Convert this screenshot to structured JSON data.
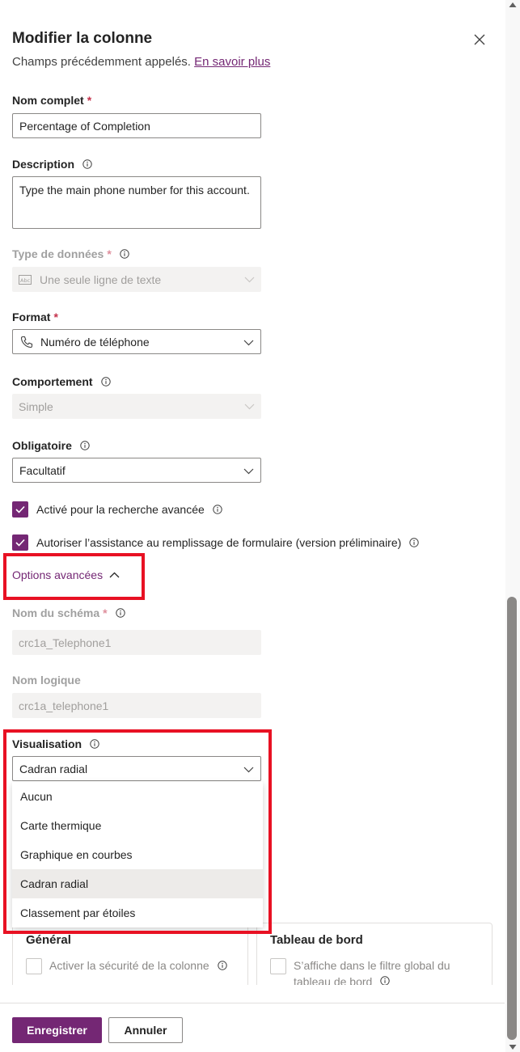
{
  "panel": {
    "title": "Modifier la colonne",
    "subtitle_prefix": "Champs précédemment appelés.",
    "learn_more_link": "En savoir plus"
  },
  "fields": {
    "display_name": {
      "label": "Nom complet",
      "required_mark": "*",
      "value": "Percentage of Completion"
    },
    "description": {
      "label": "Description",
      "value": "Type the main phone number for this account."
    },
    "data_type": {
      "label": "Type de données",
      "required_mark": "*",
      "value": "Une seule ligne de texte",
      "icon": "abc-text-icon"
    },
    "format": {
      "label": "Format",
      "required_mark": "*",
      "value": "Numéro de téléphone",
      "icon": "phone-icon"
    },
    "behavior": {
      "label": "Comportement",
      "value": "Simple"
    },
    "required": {
      "label": "Obligatoire",
      "value": "Facultatif"
    }
  },
  "checkboxes": {
    "advanced_find": {
      "label": "Activé pour la recherche avancée",
      "checked": true
    },
    "form_assist": {
      "label": "Autoriser l’assistance au remplissage de formulaire (version préliminaire)",
      "checked": true
    }
  },
  "advanced_options": {
    "toggle_label": "Options avancées",
    "schema_name": {
      "label": "Nom du schéma",
      "required_mark": "*",
      "value": "crc1a_Telephone1"
    },
    "logical_name": {
      "label": "Nom logique",
      "value": "crc1a_telephone1"
    },
    "visualization": {
      "label": "Visualisation",
      "value": "Cadran radial",
      "options": [
        "Aucun",
        "Carte thermique",
        "Graphique en courbes",
        "Cadran radial",
        "Classement par étoiles"
      ],
      "selected": "Cadran radial"
    }
  },
  "cards": {
    "general": {
      "title": "Général",
      "checkbox_label": "Activer la sécurité de la colonne"
    },
    "dashboard": {
      "title": "Tableau de bord",
      "checkbox_label_line1": "S’affiche dans le filtre global du",
      "checkbox_label_line2": "tableau de bord"
    }
  },
  "footer": {
    "save_label": "Enregistrer",
    "cancel_label": "Annuler"
  },
  "colors": {
    "accent": "#742774",
    "required": "#c4314b",
    "highlight_box": "#e81123"
  }
}
